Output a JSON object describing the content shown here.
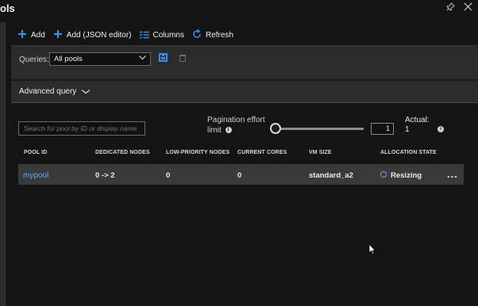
{
  "blade": {
    "title": "ols"
  },
  "toolbar": {
    "add_label": "Add",
    "add_json_label": "Add (JSON editor)",
    "columns_label": "Columns",
    "refresh_label": "Refresh"
  },
  "queries": {
    "label": "Queries:",
    "selected": "All pools"
  },
  "advanced": {
    "label": "Advanced query"
  },
  "search": {
    "placeholder": "Search for pool by ID or display name"
  },
  "pagination": {
    "label_line1": "Pagination effort",
    "label_line2": "limit",
    "value": "1",
    "actual_label": "Actual:",
    "actual_value": "1"
  },
  "table": {
    "columns": [
      "POOL ID",
      "DEDICATED NODES",
      "LOW-PRIORITY NODES",
      "CURRENT CORES",
      "VM SIZE",
      "ALLOCATION STATE"
    ],
    "rows": [
      {
        "pool_id": "mypool",
        "dedicated_nodes": "0 -> 2",
        "low_priority_nodes": "0",
        "current_cores": "0",
        "vm_size": "standard_a2",
        "allocation_state": "Resizing",
        "more": "..."
      }
    ]
  },
  "colors": {
    "accent": "#3b8eea",
    "link": "#5aa8f5",
    "background": "#141414",
    "panel": "#2b2b2b",
    "row": "#3a3a3a"
  },
  "icons": {
    "pin": "pin-icon",
    "close": "close-icon",
    "add": "plus-icon",
    "columns": "columns-icon",
    "refresh": "refresh-icon",
    "save": "save-icon",
    "delete": "trash-icon",
    "info": "info-icon",
    "status": "circle-status-icon"
  }
}
